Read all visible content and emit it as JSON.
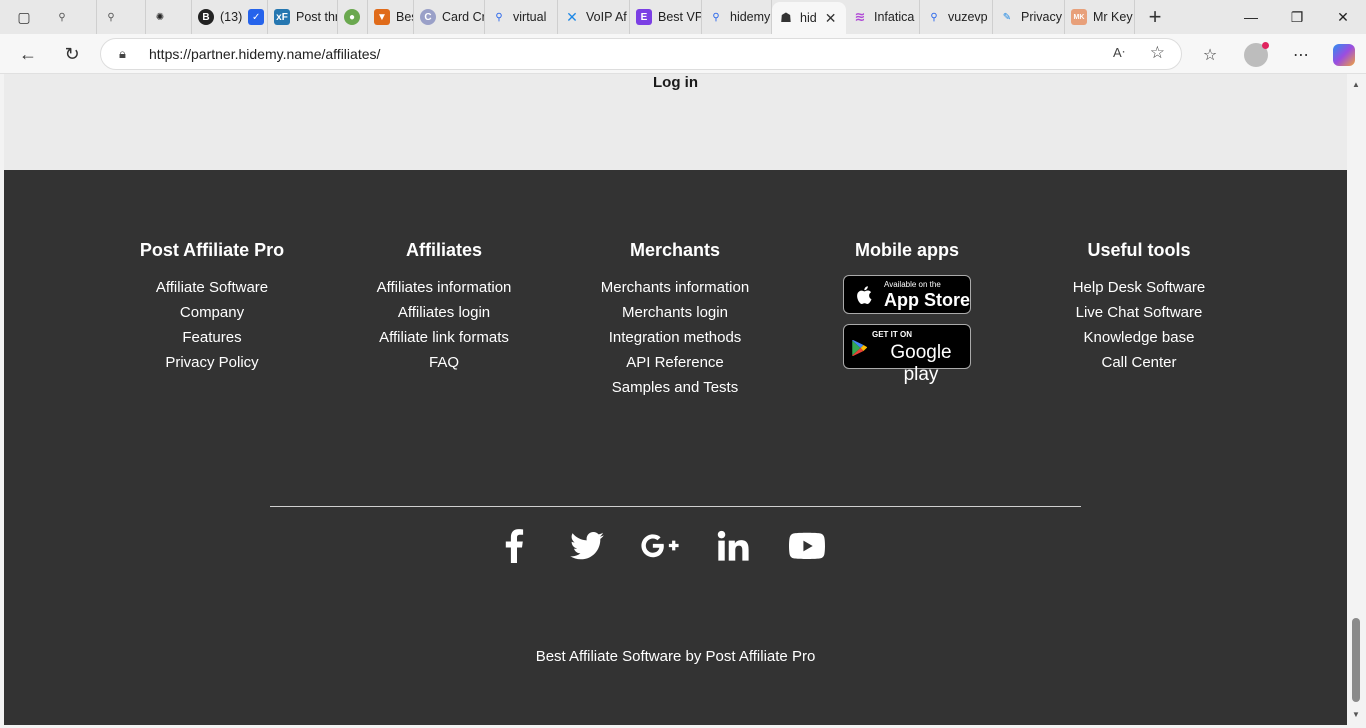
{
  "browser": {
    "tabs": [
      {
        "label": "",
        "icon": "search-icon"
      },
      {
        "label": "",
        "icon": "search-icon"
      },
      {
        "label": "",
        "icon": "openai-icon"
      },
      {
        "label": "(13)",
        "icon": "b-icon"
      },
      {
        "label": "Post thr",
        "icon": "xf-icon"
      },
      {
        "label": "Best",
        "icon": "shield-icon"
      },
      {
        "label": "Card Cr",
        "icon": "c-icon"
      },
      {
        "label": "virtual",
        "icon": "search-icon"
      },
      {
        "label": "VoIP Af",
        "icon": "x-icon"
      },
      {
        "label": "Best VP",
        "icon": "e-icon"
      },
      {
        "label": "hidemy",
        "icon": "search-icon"
      },
      {
        "label": "hid",
        "icon": "hidemy-icon",
        "active": true
      },
      {
        "label": "Infatica",
        "icon": "infatica-icon"
      },
      {
        "label": "vuzevp",
        "icon": "search-icon"
      },
      {
        "label": "Privacy",
        "icon": "edit-icon"
      },
      {
        "label": "Mr Key",
        "icon": "mrkey-icon"
      }
    ],
    "url": "https://partner.hidemy.name/affiliates/"
  },
  "page": {
    "login_label": "Log in"
  },
  "footer": {
    "col1": {
      "title": "Post Affiliate Pro",
      "links": [
        "Affiliate Software",
        "Company",
        "Features",
        "Privacy Policy"
      ]
    },
    "col2": {
      "title": "Affiliates",
      "links": [
        "Affiliates information",
        "Affiliates login",
        "Affiliate link formats",
        "FAQ"
      ]
    },
    "col3": {
      "title": "Merchants",
      "links": [
        "Merchants information",
        "Merchants login",
        "Integration methods",
        "API Reference",
        "Samples and Tests"
      ]
    },
    "col4": {
      "title": "Mobile apps",
      "appstore": {
        "small": "Available on the",
        "large": "App Store"
      },
      "googleplay": {
        "small": "GET IT ON",
        "large": "Google play"
      }
    },
    "col5": {
      "title": "Useful tools",
      "links": [
        "Help Desk Software",
        "Live Chat Software",
        "Knowledge base",
        "Call Center"
      ]
    },
    "social": [
      "facebook-icon",
      "twitter-icon",
      "google-plus-icon",
      "linkedin-icon",
      "youtube-icon"
    ],
    "credit": "Best Affiliate Software by Post Affiliate Pro"
  }
}
